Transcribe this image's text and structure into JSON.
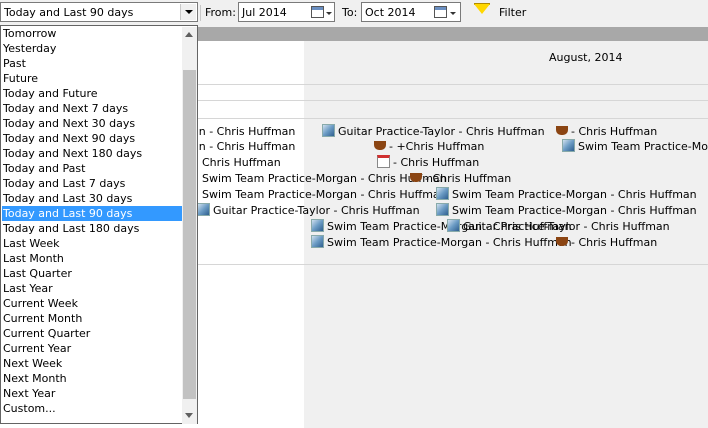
{
  "toolbar": {
    "range_value": "Today and Last 90 days",
    "from_label": "From:",
    "from_value": "Jul  2014",
    "to_label": "To:",
    "to_value": "Oct  2014",
    "filter_label": "Filter"
  },
  "calendar": {
    "month_label": "August, 2014",
    "events": [
      {
        "icon": "none",
        "text": "gan - Chris Huffman"
      },
      {
        "icon": "swim-icon",
        "text": "Guitar Practice-Taylor - Chris Huffman"
      },
      {
        "icon": "cup-icon",
        "text": "- Chris Huffman"
      },
      {
        "icon": "none",
        "text": "gan - Chris Huffman"
      },
      {
        "icon": "cup-icon",
        "text": "- +Chris Huffman"
      },
      {
        "icon": "swim-icon",
        "text": "Swim Team Practice-Morgan"
      },
      {
        "icon": "none",
        "text": "Chris Huffman"
      },
      {
        "icon": "date-icon",
        "text": "- Chris Huffman"
      },
      {
        "icon": "none",
        "text": "Swim Team Practice-Morgan - Chris Huffman"
      },
      {
        "icon": "cup-icon",
        "text": "- Chris Huffman"
      },
      {
        "icon": "none",
        "text": "Swim Team Practice-Morgan - Chris Huffman"
      },
      {
        "icon": "swim-icon",
        "text": "Swim Team Practice-Morgan - Chris Huffman"
      },
      {
        "icon": "swim-icon",
        "text": "Guitar Practice-Taylor - Chris Huffman"
      },
      {
        "icon": "swim-icon",
        "text": "Swim Team Practice-Morgan - Chris Huffman"
      },
      {
        "icon": "swim-icon",
        "text": "Swim Team Practice-Morgan - Chris Huffman"
      },
      {
        "icon": "swim-icon",
        "text": "Guitar Practice-Taylor - Chris Huffman"
      },
      {
        "icon": "swim-icon",
        "text": "Swim Team Practice-Morgan - Chris Huffman"
      },
      {
        "icon": "cup-icon",
        "text": "- Chris Huffman"
      }
    ]
  },
  "dropdown": {
    "selected_index": 12,
    "options": [
      "Tomorrow",
      "Yesterday",
      "Past",
      "Future",
      "Today and Future",
      "Today and Next 7 days",
      "Today and Next 30 days",
      "Today and Next 90 days",
      "Today and Next 180 days",
      "Today and Past",
      "Today and Last 7 days",
      "Today and Last 30 days",
      "Today and Last 90 days",
      "Today and Last 180 days",
      "Last Week",
      "Last Month",
      "Last Quarter",
      "Last Year",
      "Current Week",
      "Current Month",
      "Current Quarter",
      "Current Year",
      "Next Week",
      "Next Month",
      "Next Year",
      "Custom..."
    ]
  }
}
